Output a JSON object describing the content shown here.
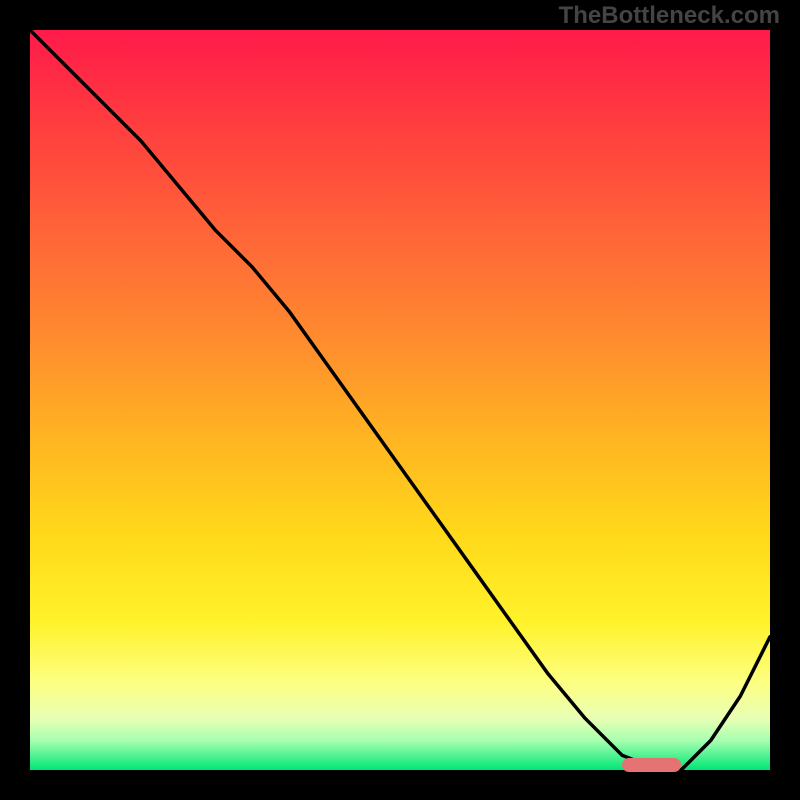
{
  "watermark": "TheBottleneck.com",
  "colors": {
    "background": "#000000",
    "gradient_top": "#ff1a4a",
    "gradient_bottom": "#00e676",
    "curve": "#000000",
    "marker": "#e57373"
  },
  "chart_data": {
    "type": "line",
    "title": "",
    "xlabel": "",
    "ylabel": "",
    "xlim": [
      0,
      100
    ],
    "ylim": [
      0,
      100
    ],
    "grid": false,
    "legend": false,
    "series": [
      {
        "name": "bottleneck-curve",
        "x": [
          0,
          5,
          10,
          15,
          20,
          25,
          30,
          35,
          40,
          45,
          50,
          55,
          60,
          65,
          70,
          75,
          80,
          85,
          88,
          92,
          96,
          100
        ],
        "values": [
          100,
          95,
          90,
          85,
          79,
          73,
          68,
          62,
          55,
          48,
          41,
          34,
          27,
          20,
          13,
          7,
          2,
          0,
          0,
          4,
          10,
          18
        ]
      }
    ],
    "marker": {
      "x_start": 80,
      "x_end": 88,
      "y": 0.5
    },
    "background_gradient": {
      "direction": "vertical",
      "stops": [
        {
          "pos": 0.0,
          "color": "#ff1a4a"
        },
        {
          "pos": 0.12,
          "color": "#ff3b3f"
        },
        {
          "pos": 0.28,
          "color": "#ff6638"
        },
        {
          "pos": 0.42,
          "color": "#ff8c2e"
        },
        {
          "pos": 0.55,
          "color": "#ffb422"
        },
        {
          "pos": 0.68,
          "color": "#ffd81a"
        },
        {
          "pos": 0.8,
          "color": "#fff22a"
        },
        {
          "pos": 0.88,
          "color": "#fdff80"
        },
        {
          "pos": 0.93,
          "color": "#e8ffb4"
        },
        {
          "pos": 0.96,
          "color": "#a8ffb0"
        },
        {
          "pos": 1.0,
          "color": "#00e676"
        }
      ]
    }
  }
}
